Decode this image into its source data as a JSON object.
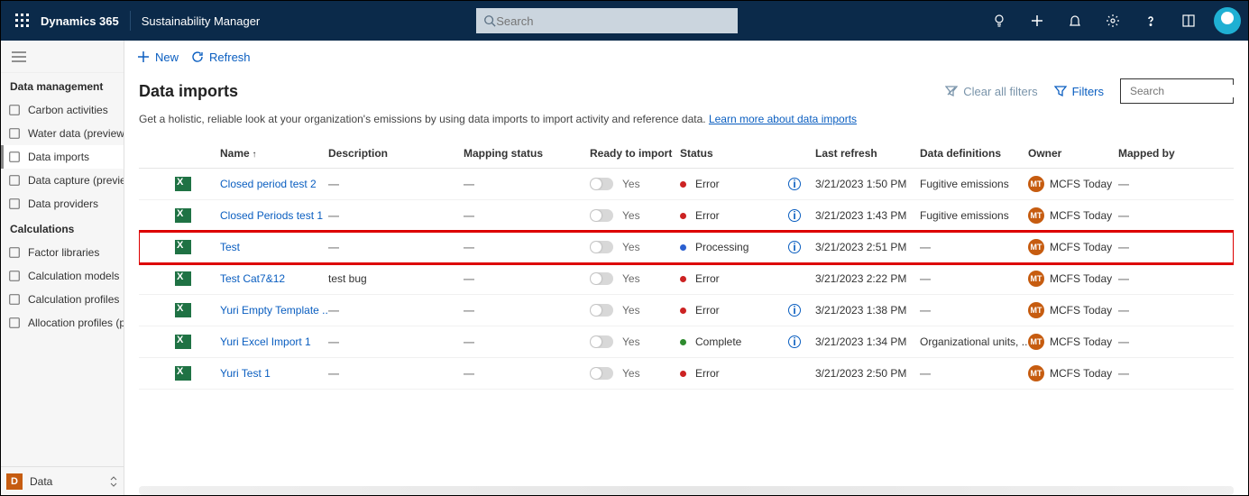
{
  "topbar": {
    "brand": "Dynamics 365",
    "app": "Sustainability Manager",
    "search_placeholder": "Search"
  },
  "cmdbar": {
    "new": "New",
    "refresh": "Refresh"
  },
  "sidebar": {
    "section1": "Data management",
    "items1": [
      {
        "label": "Carbon activities"
      },
      {
        "label": "Water data (preview)"
      },
      {
        "label": "Data imports"
      },
      {
        "label": "Data capture (preview)"
      },
      {
        "label": "Data providers"
      }
    ],
    "section2": "Calculations",
    "items2": [
      {
        "label": "Factor libraries"
      },
      {
        "label": "Calculation models"
      },
      {
        "label": "Calculation profiles"
      },
      {
        "label": "Allocation profiles (p..."
      }
    ],
    "footer": {
      "initial": "D",
      "label": "Data"
    }
  },
  "page": {
    "title": "Data imports",
    "subtext": "Get a holistic, reliable look at your organization's emissions by using data imports to import activity and reference data. ",
    "learn_link": "Learn more about data imports",
    "clear_filters": "Clear all filters",
    "filters": "Filters",
    "search_placeholder": "Search"
  },
  "columns": [
    "",
    "",
    "Name",
    "Description",
    "Mapping status",
    "Ready to import",
    "Status",
    "Last refresh",
    "Data definitions",
    "Owner",
    "Mapped by"
  ],
  "rows": [
    {
      "name": "Closed period test 2",
      "desc": "---",
      "map": "---",
      "ready": "Yes",
      "status": "Error",
      "status_kind": "err",
      "info": true,
      "refresh": "3/21/2023 1:50 PM",
      "defs": "Fugitive emissions",
      "owner_initials": "MT",
      "owner": "MCFS Today",
      "mapped": "---",
      "hl": false
    },
    {
      "name": "Closed Periods test 1",
      "desc": "---",
      "map": "---",
      "ready": "Yes",
      "status": "Error",
      "status_kind": "err",
      "info": true,
      "refresh": "3/21/2023 1:43 PM",
      "defs": "Fugitive emissions",
      "owner_initials": "MT",
      "owner": "MCFS Today",
      "mapped": "---",
      "hl": false
    },
    {
      "name": "Test",
      "desc": "---",
      "map": "---",
      "ready": "Yes",
      "status": "Processing",
      "status_kind": "proc",
      "info": true,
      "refresh": "3/21/2023 2:51 PM",
      "defs": "---",
      "owner_initials": "MT",
      "owner": "MCFS Today",
      "mapped": "---",
      "hl": true
    },
    {
      "name": "Test Cat7&12",
      "desc": "test bug",
      "map": "---",
      "ready": "Yes",
      "status": "Error",
      "status_kind": "err",
      "info": false,
      "refresh": "3/21/2023 2:22 PM",
      "defs": "---",
      "owner_initials": "MT",
      "owner": "MCFS Today",
      "mapped": "---",
      "hl": false
    },
    {
      "name": "Yuri Empty Template ...",
      "desc": "---",
      "map": "---",
      "ready": "Yes",
      "status": "Error",
      "status_kind": "err",
      "info": true,
      "refresh": "3/21/2023 1:38 PM",
      "defs": "---",
      "owner_initials": "MT",
      "owner": "MCFS Today",
      "mapped": "---",
      "hl": false
    },
    {
      "name": "Yuri Excel Import 1",
      "desc": "---",
      "map": "---",
      "ready": "Yes",
      "status": "Complete",
      "status_kind": "ok",
      "info": true,
      "refresh": "3/21/2023 1:34 PM",
      "defs": "Organizational units, ...",
      "owner_initials": "MT",
      "owner": "MCFS Today",
      "mapped": "---",
      "hl": false
    },
    {
      "name": "Yuri Test 1",
      "desc": "---",
      "map": "---",
      "ready": "Yes",
      "status": "Error",
      "status_kind": "err",
      "info": false,
      "refresh": "3/21/2023 2:50 PM",
      "defs": "---",
      "owner_initials": "MT",
      "owner": "MCFS Today",
      "mapped": "---",
      "hl": false
    }
  ]
}
